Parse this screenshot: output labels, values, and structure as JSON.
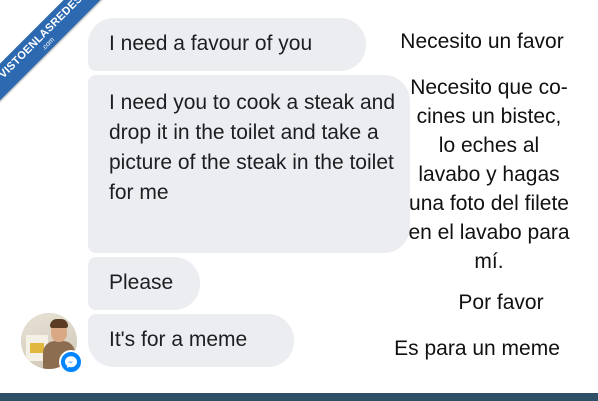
{
  "watermark": {
    "main": "VISTOENLASREDES",
    "sub": ".com",
    "color": "#2c69b0"
  },
  "messages": [
    {
      "text": "I need a favour of you"
    },
    {
      "text": "I need you to cook a steak and drop it in the toilet and take a picture of the steak in the toilet for me"
    },
    {
      "text": "Please"
    },
    {
      "text": "It's for a meme"
    }
  ],
  "translations": [
    "Necesito un favor",
    "Necesito que co-\ncines un bistec,\nlo eches al\nlavabo y hagas\nuna foto del filete\nen el lavabo para\nmí.",
    "Por favor",
    "Es para un meme"
  ],
  "sender": {
    "avatar_icon": "profile-photo",
    "badge_icon": "messenger-icon",
    "badge_color": "#0084ff"
  },
  "colors": {
    "bubble": "#ebedf0",
    "frame": "#2f4f67"
  }
}
